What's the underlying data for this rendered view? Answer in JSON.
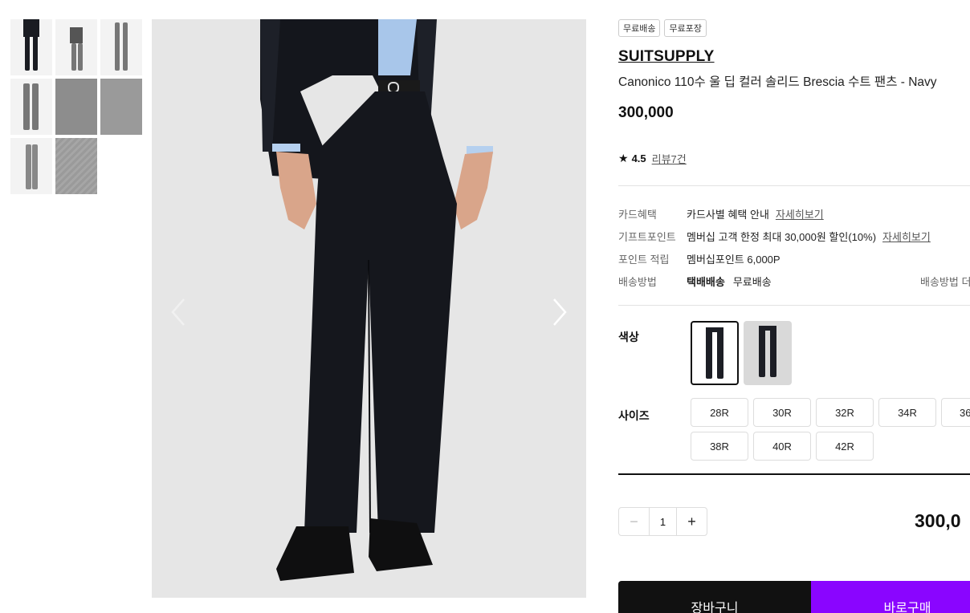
{
  "thumbnails": [
    {
      "name": "thumb-front-dark"
    },
    {
      "name": "thumb-full-body"
    },
    {
      "name": "thumb-pants-front"
    },
    {
      "name": "thumb-pants-side"
    },
    {
      "name": "thumb-pants-detail"
    },
    {
      "name": "thumb-waist-detail"
    },
    {
      "name": "thumb-pants-flat"
    },
    {
      "name": "thumb-fabric"
    }
  ],
  "gallery": {
    "prev_icon": "chevron-left-icon",
    "next_icon": "chevron-right-icon"
  },
  "product": {
    "badges": [
      "무료배송",
      "무료포장"
    ],
    "brand": "SUITSUPPLY",
    "title": "Canonico 110수 울 딥 컬러 솔리드 Brescia 수트 팬츠 - Navy",
    "price": "300,000",
    "rating": "4.5",
    "review_link": "리뷰7건"
  },
  "info": {
    "card_label": "카드혜택",
    "card_value": "카드사별 혜택 안내",
    "card_link": "자세히보기",
    "gift_label": "기프트포인트",
    "gift_value": "멤버십 고객 한정 최대 30,000원 할인(10%)",
    "gift_link": "자세히보기",
    "point_label": "포인트 적립",
    "point_value": "멤버십포인트 6,000P",
    "ship_label": "배송방법",
    "ship_method": "택배배송",
    "ship_fee": "무료배송",
    "ship_more": "배송방법 더"
  },
  "options": {
    "color_label": "색상",
    "size_label": "사이즈",
    "sizes": [
      "28R",
      "30R",
      "32R",
      "34R",
      "36",
      "38R",
      "40R",
      "42R"
    ]
  },
  "purchase": {
    "qty_minus": "−",
    "qty": "1",
    "qty_plus": "+",
    "total": "300,0",
    "cart_label": "장바구니",
    "buy_label": "바로구매"
  }
}
